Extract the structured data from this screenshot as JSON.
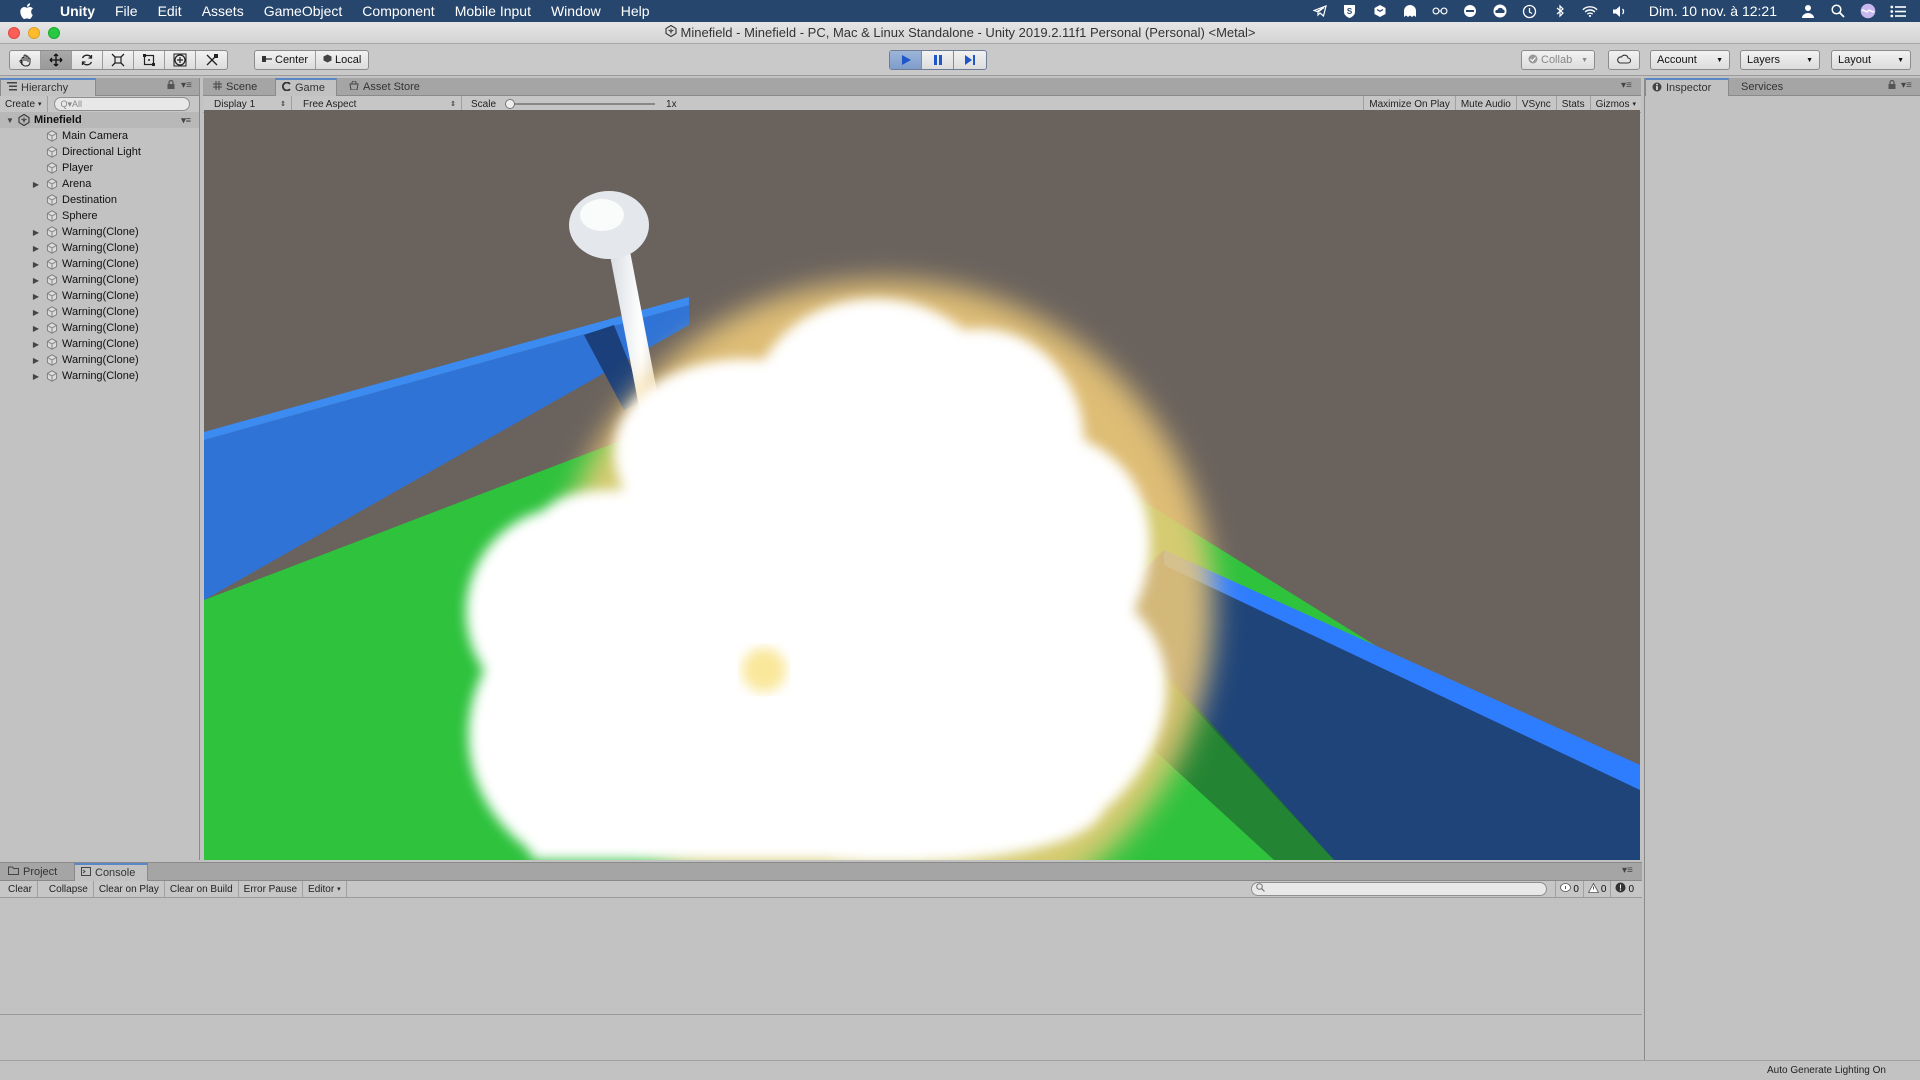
{
  "menubar": {
    "app_name": "Unity",
    "items": [
      "File",
      "Edit",
      "Assets",
      "GameObject",
      "Component",
      "Mobile Input",
      "Window",
      "Help"
    ],
    "clock": "Dim. 10 nov. à 12:21"
  },
  "window": {
    "title": "Minefield - Minefield - PC, Mac & Linux Standalone - Unity 2019.2.11f1 Personal (Personal) <Metal>"
  },
  "toolbar": {
    "pivot_center": "Center",
    "pivot_local": "Local",
    "collab": "Collab",
    "account": "Account",
    "layers": "Layers",
    "layout": "Layout"
  },
  "hierarchy": {
    "tab_label": "Hierarchy",
    "create_label": "Create",
    "search_placeholder": "Q▾All",
    "scene_name": "Minefield",
    "items": [
      {
        "label": "Main Camera",
        "foldable": false
      },
      {
        "label": "Directional Light",
        "foldable": false
      },
      {
        "label": "Player",
        "foldable": false
      },
      {
        "label": "Arena",
        "foldable": true
      },
      {
        "label": "Destination",
        "foldable": false
      },
      {
        "label": "Sphere",
        "foldable": false
      },
      {
        "label": "Warning(Clone)",
        "foldable": true
      },
      {
        "label": "Warning(Clone)",
        "foldable": true
      },
      {
        "label": "Warning(Clone)",
        "foldable": true
      },
      {
        "label": "Warning(Clone)",
        "foldable": true
      },
      {
        "label": "Warning(Clone)",
        "foldable": true
      },
      {
        "label": "Warning(Clone)",
        "foldable": true
      },
      {
        "label": "Warning(Clone)",
        "foldable": true
      },
      {
        "label": "Warning(Clone)",
        "foldable": true
      },
      {
        "label": "Warning(Clone)",
        "foldable": true
      },
      {
        "label": "Warning(Clone)",
        "foldable": true
      }
    ]
  },
  "center_tabs": {
    "scene": "Scene",
    "game": "Game",
    "asset_store": "Asset Store"
  },
  "game_bar": {
    "display": "Display 1",
    "aspect": "Free Aspect",
    "scale_label": "Scale",
    "scale_value": "1x",
    "maximize": "Maximize On Play",
    "mute": "Mute Audio",
    "vsync": "VSync",
    "stats": "Stats",
    "gizmos": "Gizmos"
  },
  "right_tabs": {
    "inspector": "Inspector",
    "services": "Services"
  },
  "bottom_tabs": {
    "project": "Project",
    "console": "Console"
  },
  "console_bar": {
    "clear": "Clear",
    "collapse": "Collapse",
    "clear_on_play": "Clear on Play",
    "clear_on_build": "Clear on Build",
    "error_pause": "Error Pause",
    "editor": "Editor",
    "info_count": "0",
    "warning_count": "0",
    "error_count": "0"
  },
  "status": {
    "lighting": "Auto Generate Lighting On"
  },
  "colors": {
    "menubar_bg": "#27466d",
    "play_active": "#7f9ccb",
    "game_sky": "#6a625d",
    "floor_green": "#2ec23d",
    "wall_blue": "#2f73d6",
    "wall_dark_blue": "#1f4479"
  }
}
